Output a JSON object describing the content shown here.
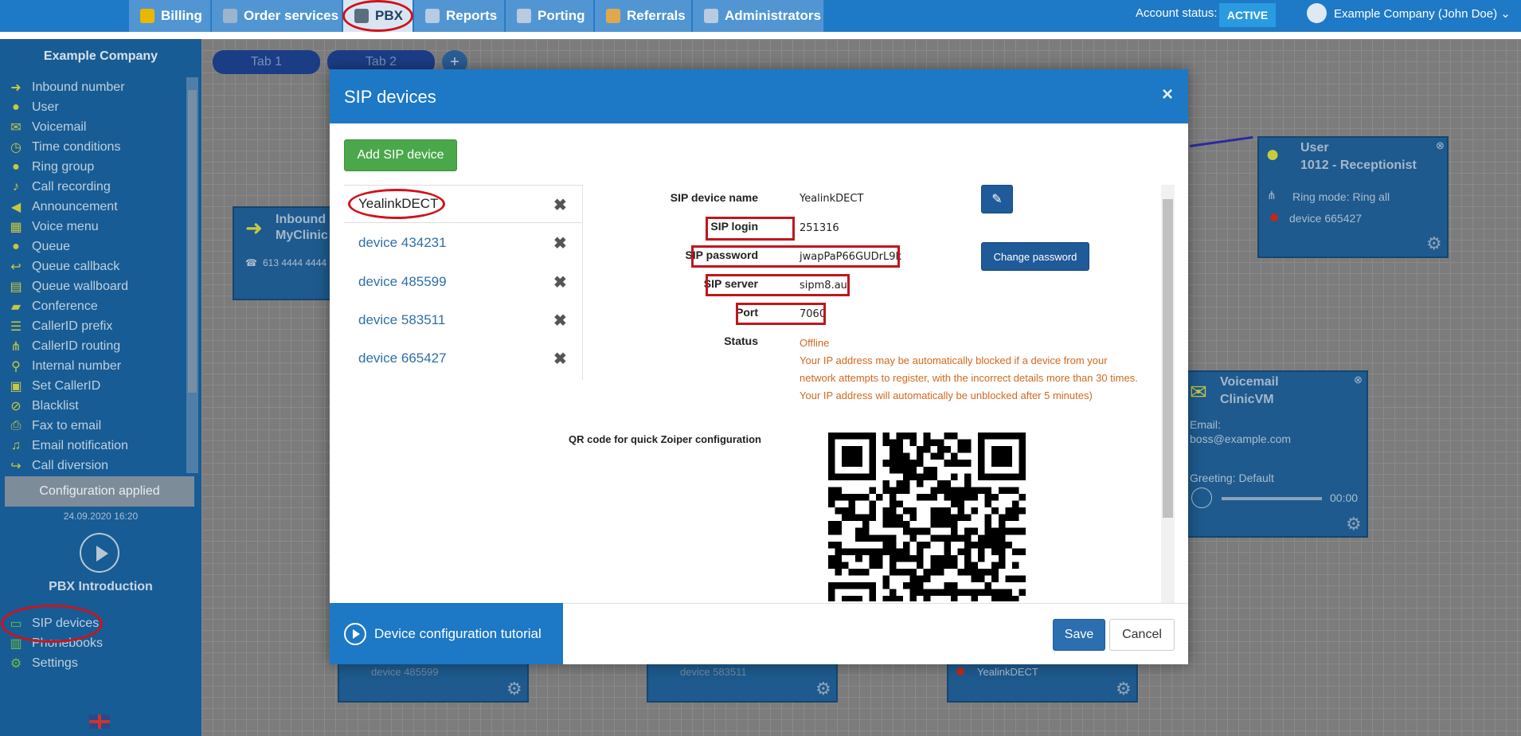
{
  "topnav": {
    "tabs": [
      {
        "label": "Billing",
        "icon": "billing-icon"
      },
      {
        "label": "Order services",
        "icon": "cart-icon"
      },
      {
        "label": "PBX",
        "icon": "pbx-icon"
      },
      {
        "label": "Reports",
        "icon": "reports-icon"
      },
      {
        "label": "Porting",
        "icon": "porting-icon"
      },
      {
        "label": "Referrals",
        "icon": "referrals-icon"
      },
      {
        "label": "Administrators",
        "icon": "administrators-icon"
      }
    ],
    "account_status_label": "Account status:",
    "account_status": "ACTIVE",
    "user_label": "Example Company (John Doe)",
    "colors": {
      "bar": "#1e7ac6",
      "tab": "#5196d3",
      "active_tab": "#d9e6f2",
      "badge": "#2a9be0"
    }
  },
  "sidebar": {
    "company": "Example Company",
    "items": [
      {
        "label": "Inbound number",
        "icon": "arrow-right-icon"
      },
      {
        "label": "User",
        "icon": "user-icon"
      },
      {
        "label": "Voicemail",
        "icon": "envelope-icon"
      },
      {
        "label": "Time conditions",
        "icon": "clock-icon"
      },
      {
        "label": "Ring group",
        "icon": "users-icon"
      },
      {
        "label": "Call recording",
        "icon": "microphone-icon"
      },
      {
        "label": "Announcement",
        "icon": "bullhorn-icon"
      },
      {
        "label": "Voice menu",
        "icon": "grid-icon"
      },
      {
        "label": "Queue",
        "icon": "user-plus-icon"
      },
      {
        "label": "Queue callback",
        "icon": "reply-icon"
      },
      {
        "label": "Queue wallboard",
        "icon": "table-icon"
      },
      {
        "label": "Conference",
        "icon": "comments-icon"
      },
      {
        "label": "CallerID prefix",
        "icon": "list-icon"
      },
      {
        "label": "CallerID routing",
        "icon": "sitemap-icon"
      },
      {
        "label": "Internal number",
        "icon": "map-marker-icon"
      },
      {
        "label": "Set CallerID",
        "icon": "id-card-icon"
      },
      {
        "label": "Blacklist",
        "icon": "ban-icon"
      },
      {
        "label": "Fax to email",
        "icon": "print-icon"
      },
      {
        "label": "Email notification",
        "icon": "bell-icon"
      },
      {
        "label": "Call diversion",
        "icon": "share-icon"
      }
    ],
    "config_status": "Configuration applied",
    "config_date": "24.09.2020 16:20",
    "intro": "PBX Introduction",
    "bottom_items": [
      {
        "label": "SIP devices",
        "icon": "monitor-icon"
      },
      {
        "label": "Phonebooks",
        "icon": "book-icon"
      },
      {
        "label": "Settings",
        "icon": "gear-icon"
      }
    ]
  },
  "canvas": {
    "tabs": [
      "Tab 1",
      "Tab 2"
    ],
    "add_tab": "+",
    "inbound_node": {
      "title_line1": "Inbound",
      "title_line2": "MyClinic",
      "phone": "613 4444 4444"
    },
    "user_node": {
      "title": "User",
      "name": "1012 - Receptionist",
      "ring_mode": "Ring mode: Ring all",
      "device": "device 665427"
    },
    "voicemail_node": {
      "title": "Voicemail",
      "name": "ClinicVM",
      "email_label": "Email:",
      "email": "boss@example.com",
      "greeting": "Greeting: Default",
      "time": "00:00"
    },
    "bottom_nodes": [
      "device 485599",
      "device 583511",
      "YealinkDECT"
    ]
  },
  "modal": {
    "title": "SIP devices",
    "close": "×",
    "add_button": "Add SIP device",
    "devices": [
      "YealinkDECT",
      "device 434231",
      "device 485599",
      "device 583511",
      "device 665427"
    ],
    "remove_glyph": "✖",
    "fields": {
      "name_label": "SIP device name",
      "name": "YealinkDECT",
      "login_label": "SIP login",
      "login": "251316",
      "password_label": "SIP password",
      "password": "jwapPaP66GUDrL9k",
      "server_label": "SIP server",
      "server": "sipm8.au",
      "port_label": "Port",
      "port": "7060",
      "status_label": "Status",
      "status": "Offline",
      "status_note": "Your IP address may be automatically blocked if a device from your network attempts to register, with the incorrect details more than 30 times. Your IP address will automatically be unblocked after 5 minutes)"
    },
    "edit_icon": "edit-icon",
    "change_password": "Change password",
    "qr_label": "QR code for quick Zoiper configuration",
    "tutorial": "Device configuration tutorial",
    "save": "Save",
    "cancel": "Cancel",
    "colors": {
      "header": "#1d78c6",
      "add_button": "#4aa84a",
      "status_warn": "#d2691e",
      "primary_button": "#1f5a99"
    }
  }
}
